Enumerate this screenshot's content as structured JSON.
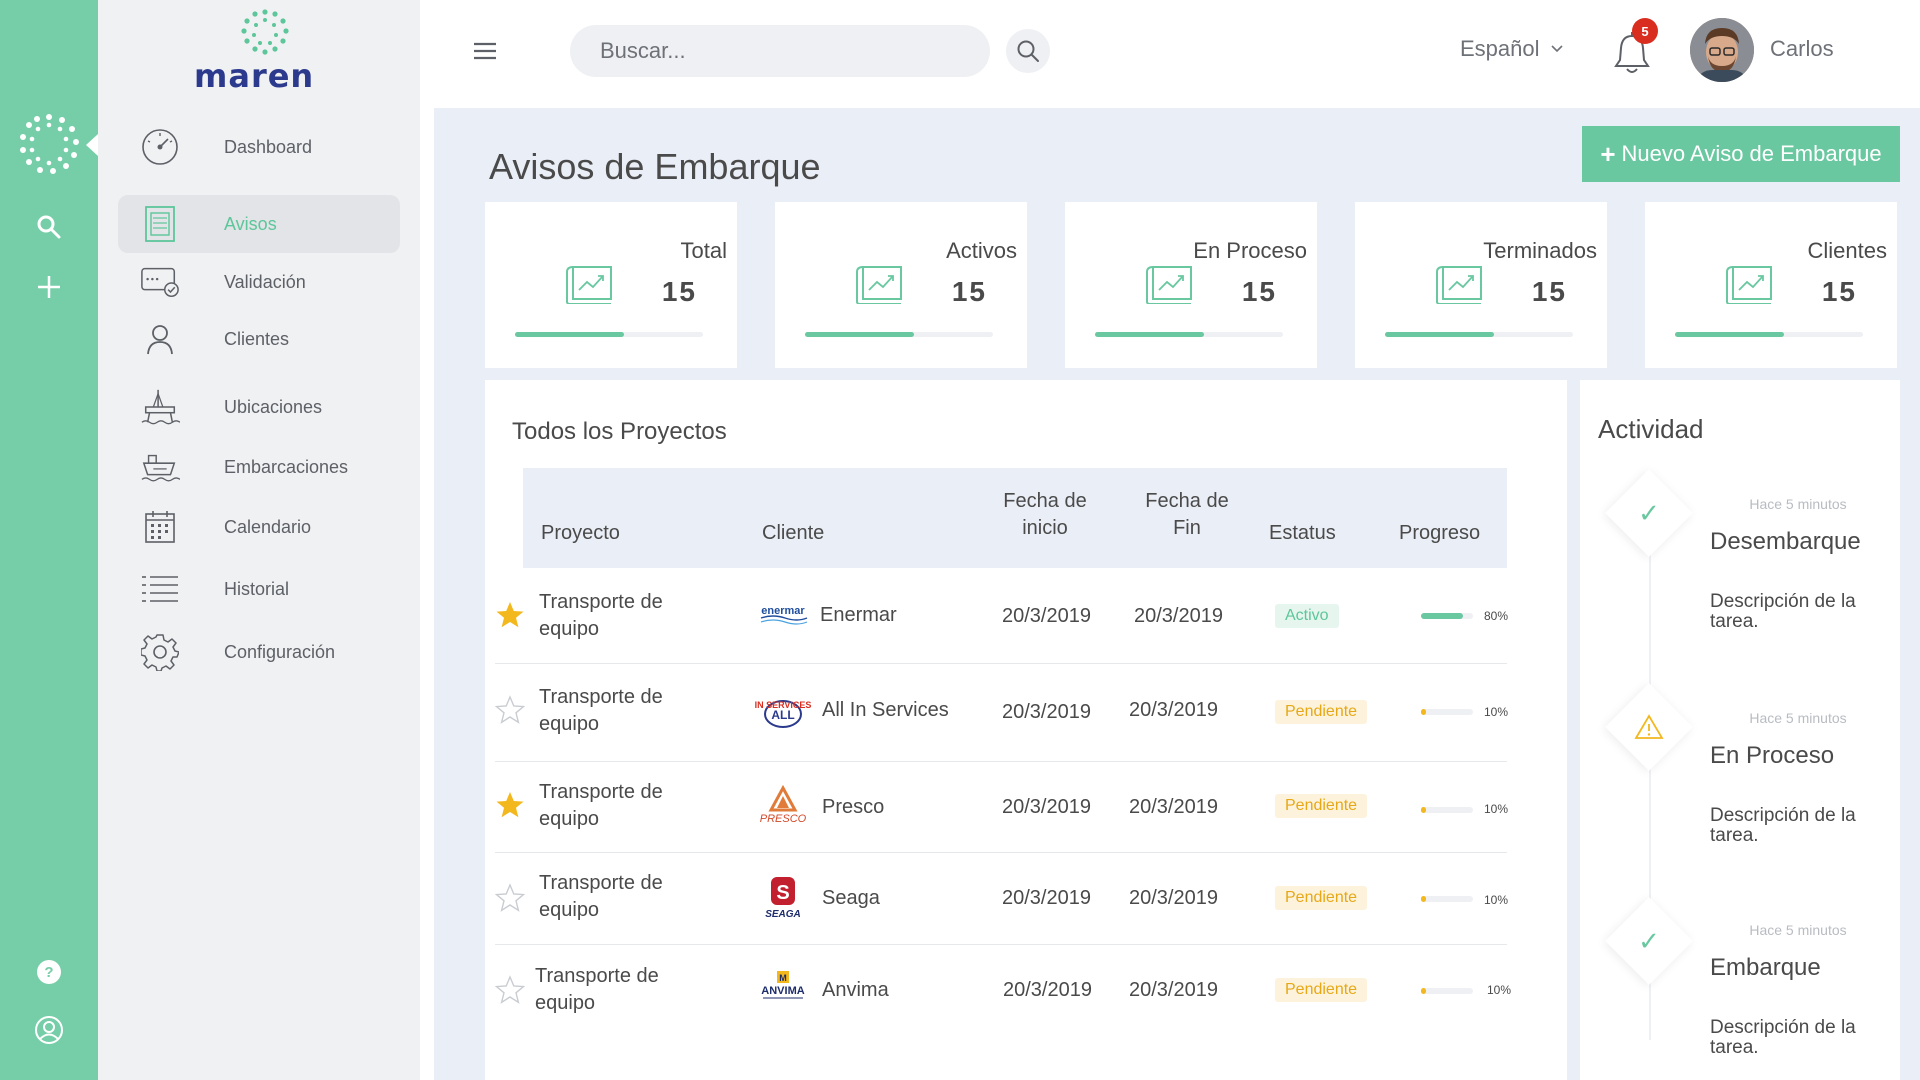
{
  "brand": {
    "name": "maren"
  },
  "colors": {
    "accent": "#76cea9",
    "button": "#6ac8a1",
    "active_text": "#5dc69a",
    "pending": "#e6a816",
    "badge": "#d92e1f"
  },
  "rail": {
    "icons": [
      "maren-mark-icon",
      "search-icon",
      "plus-icon",
      "help-icon",
      "user-circle-icon"
    ]
  },
  "sidebar": {
    "items": [
      {
        "label": "Dashboard",
        "icon": "speedometer-icon"
      },
      {
        "label": "Avisos",
        "icon": "document-list-icon",
        "active": true
      },
      {
        "label": "Validación",
        "icon": "card-check-icon"
      },
      {
        "label": "Clientes",
        "icon": "user-icon"
      },
      {
        "label": "Ubicaciones",
        "icon": "oil-platform-icon"
      },
      {
        "label": "Embarcaciones",
        "icon": "ship-icon"
      },
      {
        "label": "Calendario",
        "icon": "calendar-icon"
      },
      {
        "label": "Historial",
        "icon": "list-icon"
      },
      {
        "label": "Configuración",
        "icon": "gear-icon"
      }
    ]
  },
  "topbar": {
    "search_placeholder": "Buscar...",
    "language": "Español",
    "notifications_count": "5",
    "user_name": "Carlos"
  },
  "main": {
    "title": "Avisos de Embarque",
    "new_button": "Nuevo Aviso de Embarque",
    "stats": [
      {
        "label": "Total",
        "value": "15",
        "progress": 0.58
      },
      {
        "label": "Activos",
        "value": "15",
        "progress": 0.58
      },
      {
        "label": "En Proceso",
        "value": "15",
        "progress": 0.58
      },
      {
        "label": "Terminados",
        "value": "15",
        "progress": 0.58
      },
      {
        "label": "Clientes",
        "value": "15",
        "progress": 0.58
      }
    ],
    "projects": {
      "title": "Todos los Proyectos",
      "columns": [
        "Proyecto",
        "Cliente",
        "Fecha de inicio",
        "Fecha de Fin",
        "Estatus",
        "Progreso"
      ],
      "rows": [
        {
          "starred": true,
          "project": "Transporte de equipo",
          "client": "Enermar",
          "start": "20/3/2019",
          "end": "20/3/2019",
          "status": "Activo",
          "progress": "80%"
        },
        {
          "starred": false,
          "project": "Transporte de equipo",
          "client": "All In Services",
          "start": "20/3/2019",
          "end": "20/3/2019",
          "status": "Pendiente",
          "progress": "10%"
        },
        {
          "starred": true,
          "project": "Transporte de equipo",
          "client": "Presco",
          "start": "20/3/2019",
          "end": "20/3/2019",
          "status": "Pendiente",
          "progress": "10%"
        },
        {
          "starred": false,
          "project": "Transporte de equipo",
          "client": "Seaga",
          "start": "20/3/2019",
          "end": "20/3/2019",
          "status": "Pendiente",
          "progress": "10%"
        },
        {
          "starred": false,
          "project": "Transporte de equipo",
          "client": "Anvima",
          "start": "20/3/2019",
          "end": "20/3/2019",
          "status": "Pendiente",
          "progress": "10%"
        }
      ]
    },
    "activity": {
      "title": "Actividad",
      "items": [
        {
          "time": "Hace 5 minutos",
          "name": "Desembarque",
          "description": "Descripción de la tarea.",
          "icon": "check-icon"
        },
        {
          "time": "Hace 5 minutos",
          "name": "En Proceso",
          "description": "Descripción de la tarea.",
          "icon": "warning-icon"
        },
        {
          "time": "Hace 5 minutos",
          "name": "Embarque",
          "description": "Descripción de la tarea.",
          "icon": "check-icon"
        }
      ]
    }
  }
}
